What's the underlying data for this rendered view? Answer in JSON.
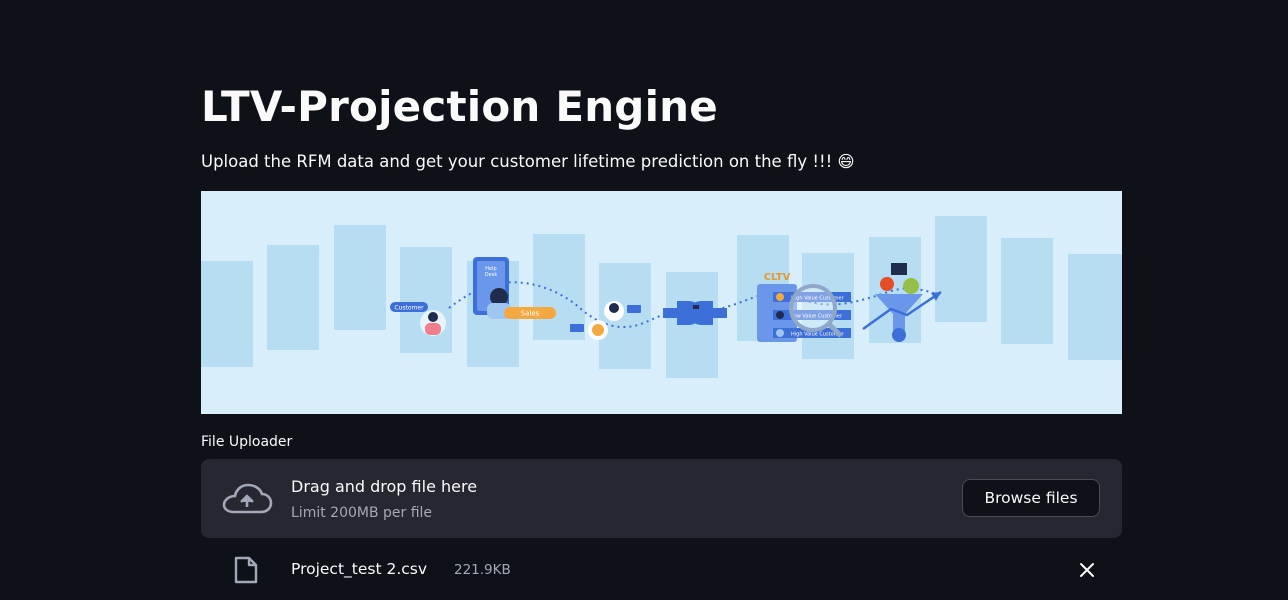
{
  "page": {
    "title": "LTV-Projection Engine",
    "subtitle": "Upload the RFM data and get your customer lifetime prediction on the fly !!! 😄"
  },
  "banner": {
    "labels": {
      "customer": "Customer",
      "help_desk_line1": "Help",
      "help_desk_line2": "Desk",
      "sales": "Sales",
      "cltv": "CLTV",
      "high_value": "High Value Customer",
      "low_value": "Low Value Customer",
      "high_value_2": "High Value Customer"
    },
    "colors": {
      "background": "#d8eefa",
      "bars": "#b7ddf3",
      "accent_blue": "#3d6fd9",
      "accent_orange": "#f3a940",
      "cltv_orange": "#e49a2c"
    }
  },
  "uploader": {
    "label": "File Uploader",
    "drop_title": "Drag and drop file here",
    "limit_text": "Limit 200MB per file",
    "browse_label": "Browse files",
    "cloud_icon": "cloud-upload-icon"
  },
  "file": {
    "name": "Project_test 2.csv",
    "size": "221.9KB",
    "file_icon": "file-icon",
    "remove_icon": "close-icon"
  }
}
